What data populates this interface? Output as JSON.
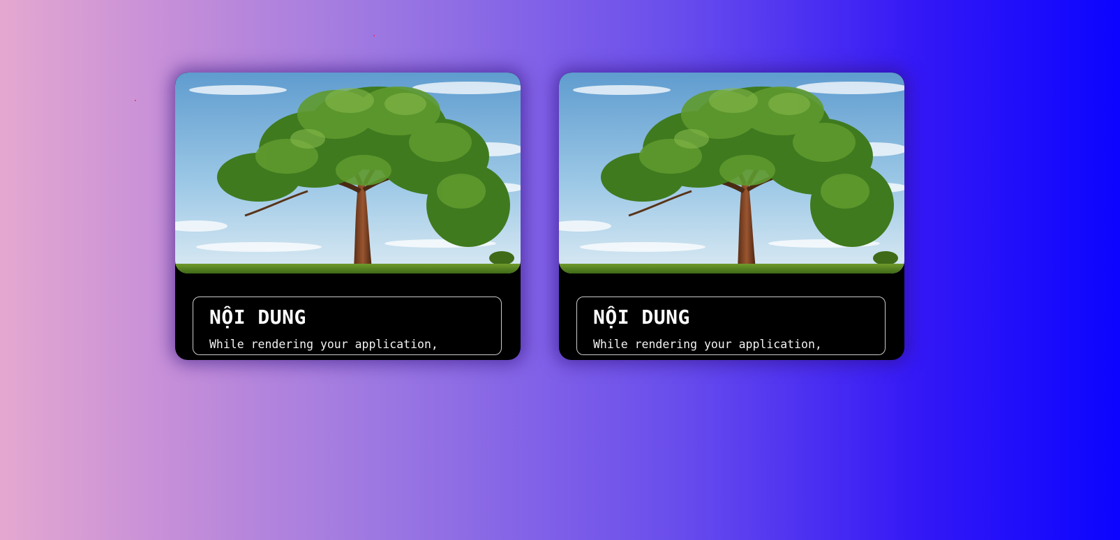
{
  "cards": [
    {
      "image": "tree-landscape-image",
      "title": "NỘI DUNG",
      "text": "While rendering your application,"
    },
    {
      "image": "tree-landscape-image",
      "title": "NỘI DUNG",
      "text": "While rendering your application,"
    }
  ],
  "colors": {
    "background_gradient_start": "#e4a8d0",
    "background_gradient_end": "#0b04ff",
    "card_background": "#000000",
    "card_border": "#ffffff",
    "text": "#ffffff"
  }
}
